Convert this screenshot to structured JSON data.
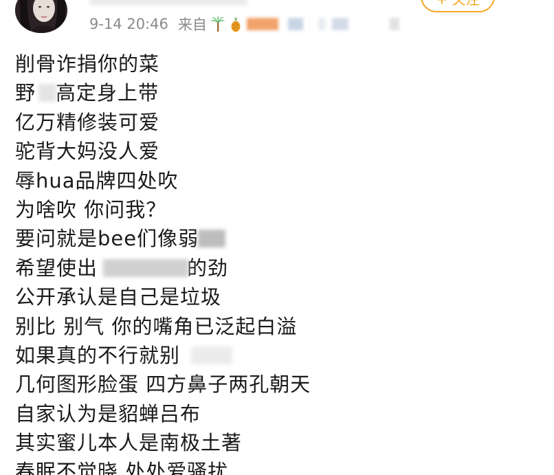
{
  "header": {
    "follow_label": "+ 关注",
    "time": "9-14 20:46",
    "source_label": "来自",
    "palm_icon": "palm-tree-emoji",
    "pineapple_icon": "pineapple-emoji"
  },
  "post": {
    "lines": [
      "削骨诈捐你的菜",
      "野",
      "高定身上带",
      "亿万精修装可爱",
      "驼背大妈没人爱",
      "辱hua品牌四处吹",
      "为啥吹 你问我？",
      "要问就是bee们像弱",
      "希望使出",
      "的劲",
      "公开承认是自己是垃圾",
      "别比 别气 你的嘴角已泛起白溢",
      "如果真的不行就别",
      "几何图形脸蛋  四方鼻子两孔朝天",
      "自家认为是貂蝉吕布",
      "其实蜜儿本人是南极土著",
      "春眠不觉晓  处处爱骚扰"
    ]
  },
  "colors": {
    "accent": "#f5a623",
    "meta_text": "#8a8a8a",
    "body_text": "#1a1a1a"
  }
}
